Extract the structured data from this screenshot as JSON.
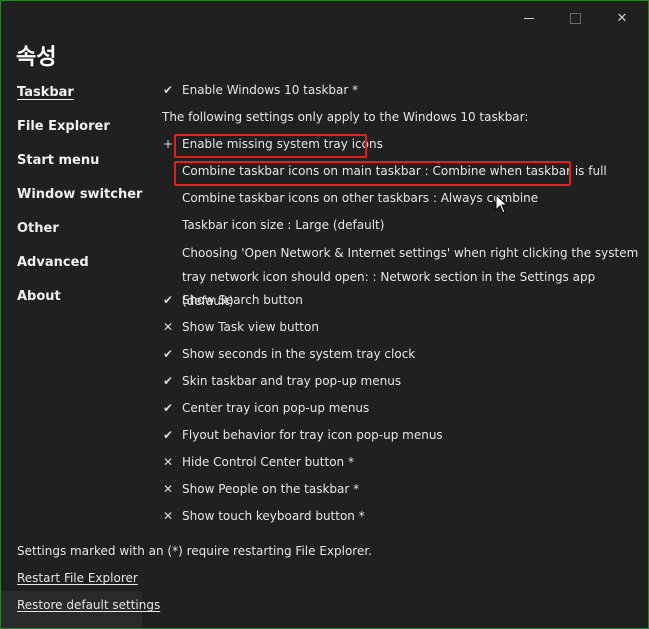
{
  "window": {
    "title": "속성",
    "controls": {
      "minimize": "minimize",
      "maximize": "maximize",
      "close": "✕"
    }
  },
  "nav": {
    "items": [
      {
        "label": "Taskbar",
        "active": true
      },
      {
        "label": "File Explorer"
      },
      {
        "label": "Start menu"
      },
      {
        "label": "Window switcher"
      },
      {
        "label": "Other"
      },
      {
        "label": "Advanced"
      },
      {
        "label": "About"
      }
    ]
  },
  "settings": {
    "rows": [
      {
        "mark": "✔",
        "label": "Enable Windows 10 taskbar *"
      },
      {
        "mark": "",
        "label": "The following settings only apply to the Windows 10 taskbar:"
      },
      {
        "mark": "+",
        "label": "Enable missing system tray icons"
      },
      {
        "mark": "",
        "label": "Combine taskbar icons on main taskbar : Combine when taskbar is full"
      },
      {
        "mark": "",
        "label": "Combine taskbar icons on other taskbars : Always combine"
      },
      {
        "mark": "",
        "label": "Taskbar icon size : Large (default)"
      },
      {
        "mark": "",
        "label": "Choosing 'Open Network & Internet settings' when right clicking the system tray network icon should open: : Network section in the Settings app (default)"
      },
      {
        "mark": "✔",
        "label": "Show Search button"
      },
      {
        "mark": "✕",
        "label": "Show Task view button"
      },
      {
        "mark": "✔",
        "label": "Show seconds in the system tray clock"
      },
      {
        "mark": "✔",
        "label": "Skin taskbar and tray pop-up menus"
      },
      {
        "mark": "✔",
        "label": "Center tray icon pop-up menus"
      },
      {
        "mark": "✔",
        "label": "Flyout behavior for tray icon pop-up menus"
      },
      {
        "mark": "✕",
        "label": "Hide Control Center button *"
      },
      {
        "mark": "✕",
        "label": "Show People on the taskbar *"
      },
      {
        "mark": "✕",
        "label": "Show touch keyboard button *"
      }
    ]
  },
  "footer": {
    "note": "Settings marked with an (*) require restarting File Explorer.",
    "restart_link": "Restart File Explorer",
    "restore_link": "Restore default settings"
  },
  "colors": {
    "background": "#202020",
    "text": "#e6e6e6",
    "highlight_box": "#e02020",
    "window_border": "#2e7d32"
  }
}
